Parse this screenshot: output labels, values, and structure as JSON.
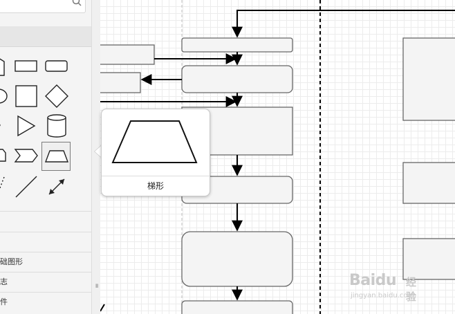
{
  "sidebar": {
    "search": {
      "placeholder": "",
      "icon": "search-icon"
    },
    "section": {
      "label": ""
    },
    "shapes": [
      {
        "name": "document",
        "icon": "document-shape-icon"
      },
      {
        "name": "rectangle",
        "icon": "rectangle-shape-icon"
      },
      {
        "name": "rounded-rectangle",
        "icon": "rounded-rectangle-shape-icon"
      },
      {
        "name": "ellipse",
        "icon": "ellipse-shape-icon"
      },
      {
        "name": "square",
        "icon": "square-shape-icon"
      },
      {
        "name": "diamond",
        "icon": "diamond-shape-icon"
      },
      {
        "name": "hexagon",
        "icon": "hexagon-shape-icon"
      },
      {
        "name": "triangle",
        "icon": "triangle-shape-icon"
      },
      {
        "name": "cylinder",
        "icon": "cylinder-shape-icon"
      },
      {
        "name": "card",
        "icon": "card-shape-icon"
      },
      {
        "name": "step",
        "icon": "step-shape-icon"
      },
      {
        "name": "trapezoid",
        "icon": "trapezoid-shape-icon",
        "selected": true
      },
      {
        "name": "dotted-line",
        "icon": "dotted-line-icon"
      },
      {
        "name": "line",
        "icon": "line-icon"
      },
      {
        "name": "bidirectional-arrow",
        "icon": "bidirectional-arrow-icon"
      }
    ],
    "categories": [
      {
        "label": ""
      },
      {
        "label": "础图形"
      },
      {
        "label": "志"
      },
      {
        "label": "件"
      }
    ]
  },
  "tooltip": {
    "title": "梯形",
    "preview_icon": "trapezoid-preview-icon"
  },
  "resize_handle": {
    "grip": "॥"
  },
  "colors": {
    "shape_fill": "#f4f4f4",
    "shape_stroke": "#666666",
    "connector": "#000000",
    "grid": "#ececec",
    "sidebar_bg": "#f4f4f4"
  },
  "watermark": {
    "brand": "Bai",
    "brand_suffix": "du",
    "jingyan": "经验",
    "url": "jingyan.baidu.com"
  }
}
